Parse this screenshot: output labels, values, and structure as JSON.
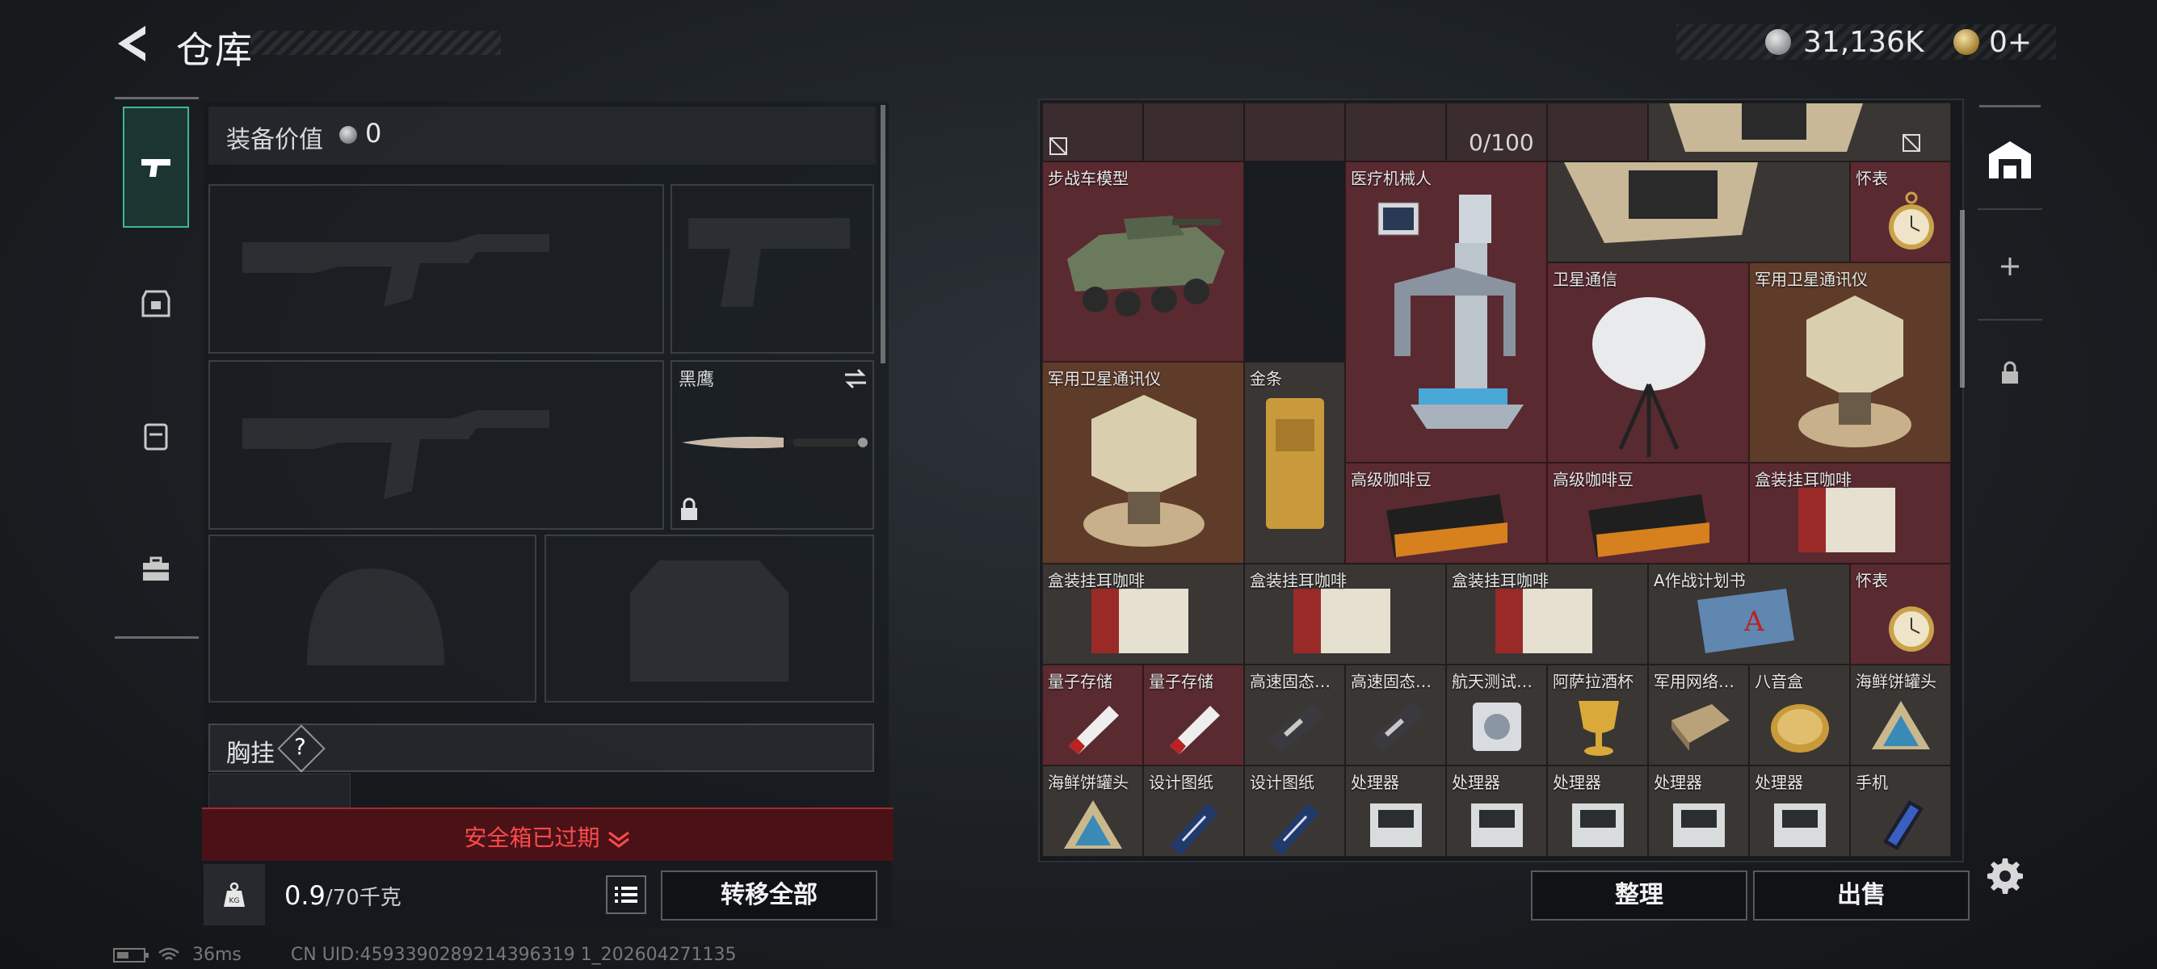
{
  "header": {
    "title": "仓库",
    "currency_primary": "31,136K",
    "currency_secondary": "0+"
  },
  "sidebar": {
    "tabs": [
      {
        "name": "weapons",
        "active": true
      },
      {
        "name": "armor",
        "active": false
      },
      {
        "name": "backpack",
        "active": false
      },
      {
        "name": "case",
        "active": false
      }
    ]
  },
  "equipment": {
    "value_label": "装备价值",
    "value": "0",
    "melee_name": "黑鹰",
    "chest_rig_label": "胸挂",
    "chest_rig_help": "?",
    "safe_box_status": "安全箱已过期",
    "weight_current": "0.9",
    "weight_limit": "/70千克",
    "transfer_all": "转移全部"
  },
  "storage": {
    "capacity": "0/100",
    "items": [
      {
        "name": "步战车模型"
      },
      {
        "name": "医疗机械人"
      },
      {
        "name": "怀表"
      },
      {
        "name": "卫星通信"
      },
      {
        "name": "军用卫星通讯仪"
      },
      {
        "name": "军用卫星通讯仪"
      },
      {
        "name": "金条"
      },
      {
        "name": "高级咖啡豆"
      },
      {
        "name": "高级咖啡豆"
      },
      {
        "name": "盒装挂耳咖啡"
      },
      {
        "name": "盒装挂耳咖啡"
      },
      {
        "name": "盒装挂耳咖啡"
      },
      {
        "name": "盒装挂耳咖啡"
      },
      {
        "name": "A作战计划书"
      },
      {
        "name": "怀表"
      },
      {
        "name": "量子存储"
      },
      {
        "name": "量子存储"
      },
      {
        "name": "高速固态…"
      },
      {
        "name": "高速固态…"
      },
      {
        "name": "航天测试…"
      },
      {
        "name": "阿萨拉酒杯"
      },
      {
        "name": "军用网络…"
      },
      {
        "name": "八音盒"
      },
      {
        "name": "海鲜饼罐头"
      },
      {
        "name": "海鲜饼罐头"
      },
      {
        "name": "设计图纸"
      },
      {
        "name": "设计图纸"
      },
      {
        "name": "处理器"
      },
      {
        "name": "处理器"
      },
      {
        "name": "处理器"
      },
      {
        "name": "处理器"
      },
      {
        "name": "处理器"
      },
      {
        "name": "手机"
      }
    ],
    "organize": "整理",
    "sell": "出售"
  },
  "status": {
    "ping": "36ms",
    "uid": "CN UID:4593390289214396319 1_202604271135"
  },
  "colors": {
    "accent_green": "#3fb59a",
    "expired_red": "#ff4a4a",
    "cell_red": "#5a2a31"
  }
}
